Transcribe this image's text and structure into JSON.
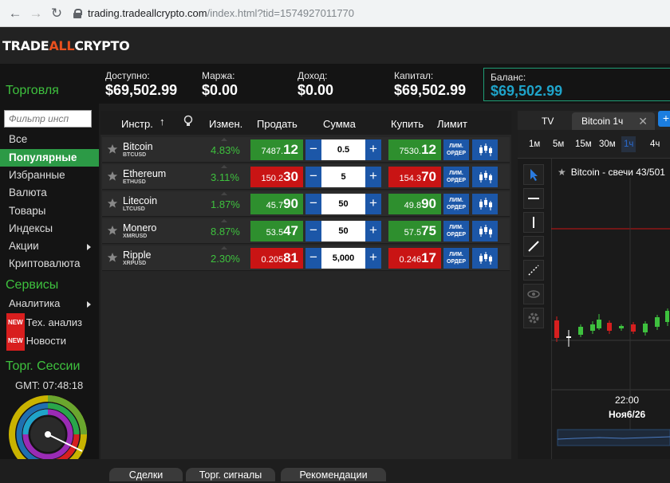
{
  "browser": {
    "url_host": "trading.tradeallcrypto.com",
    "url_path": "/index.html?tid=1574927011770"
  },
  "logo": {
    "part1": "TRADE",
    "part2": "ALL",
    "part3": "CRYPTO"
  },
  "stats": {
    "available": {
      "label": "Доступно:",
      "value": "$69,502.99"
    },
    "margin": {
      "label": "Маржа:",
      "value": "$0.00"
    },
    "income": {
      "label": "Доход:",
      "value": "$0.00"
    },
    "capital": {
      "label": "Капитал:",
      "value": "$69,502.99"
    },
    "balance": {
      "label": "Баланс:",
      "value": "$69,502.99"
    }
  },
  "sidebar": {
    "trading_title": "Торговля",
    "filter_placeholder": "Фильтр инсп",
    "categories": [
      "Все",
      "Популярные",
      "Избранные",
      "Валюта",
      "Товары",
      "Индексы",
      "Акции",
      "Криптовалюта"
    ],
    "services_title": "Сервисы",
    "services": {
      "analytics": "Аналитика",
      "tech": "Тех. анализ",
      "news": "Новости",
      "new_badge": "NEW"
    },
    "sessions_title": "Торг. Сессии",
    "gmt": "GMT: 07:48:18"
  },
  "table": {
    "headers": {
      "instrument": "Инстр.",
      "change": "Измен.",
      "sell": "Продать",
      "amount": "Сумма",
      "buy": "Купить",
      "limit": "Лимит"
    },
    "lim_label_1": "ЛИМ.",
    "lim_label_2": "ОРДЕР",
    "rows": [
      {
        "name": "Bitcoin",
        "code": "BTCUSD",
        "change": "4.83%",
        "sell_small": "7487.",
        "sell_big": "12",
        "sell_color": "green",
        "amount": "0.5",
        "buy_small": "7530.",
        "buy_big": "12",
        "buy_color": "green"
      },
      {
        "name": "Ethereum",
        "code": "ETHUSD",
        "change": "3.11%",
        "sell_small": "150.2",
        "sell_big": "30",
        "sell_color": "red",
        "amount": "5",
        "buy_small": "154.3",
        "buy_big": "70",
        "buy_color": "red"
      },
      {
        "name": "Litecoin",
        "code": "LTCUSD",
        "change": "1.87%",
        "sell_small": "45.7",
        "sell_big": "90",
        "sell_color": "green",
        "amount": "50",
        "buy_small": "49.8",
        "buy_big": "90",
        "buy_color": "green"
      },
      {
        "name": "Monero",
        "code": "XMRUSD",
        "change": "8.87%",
        "sell_small": "53.5",
        "sell_big": "47",
        "sell_color": "green",
        "amount": "50",
        "buy_small": "57.5",
        "buy_big": "75",
        "buy_color": "green"
      },
      {
        "name": "Ripple",
        "code": "XRPUSD",
        "change": "2.30%",
        "sell_small": "0.205",
        "sell_big": "81",
        "sell_color": "red",
        "amount": "5,000",
        "buy_small": "0.246",
        "buy_big": "17",
        "buy_color": "red"
      }
    ]
  },
  "chart": {
    "tab_tv": "TV",
    "tab_active": "Bitcoin 1ч",
    "tab_add": "+",
    "timeframes": [
      "1м",
      "5м",
      "15м",
      "30м",
      "1ч",
      "4ч"
    ],
    "title": "Bitcoin - свечи 43/501",
    "x_time": "22:00",
    "x_date": "Ноя6/26"
  },
  "bottom_tabs": [
    "Сделки",
    "Торг. сигналы",
    "Рекомендации"
  ],
  "colors": {
    "accent_green": "#3ec13e",
    "row_active": "#2c9a46",
    "price_green": "#2e8f2e",
    "price_red": "#c91414",
    "button_blue": "#1c57a8",
    "balance_cyan": "#1fa3c9",
    "logo_orange": "#e8501e"
  }
}
